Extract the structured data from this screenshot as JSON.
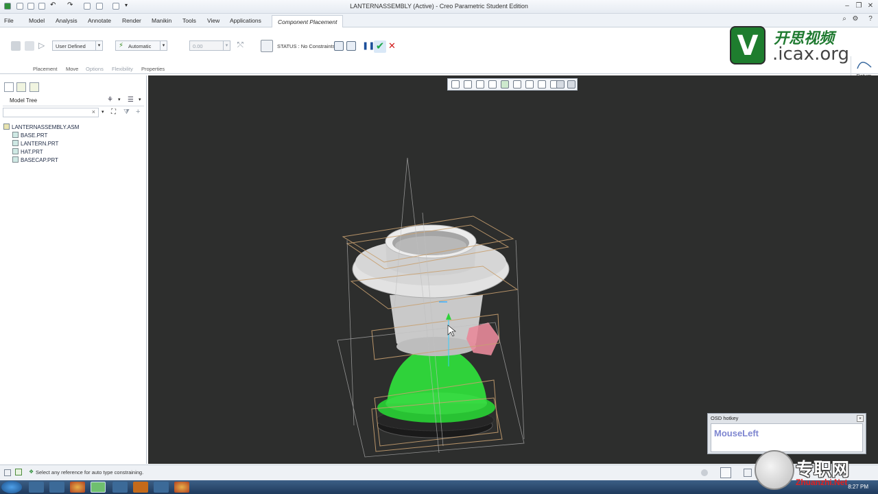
{
  "window": {
    "title": "LANTERNASSEMBLY (Active) - Creo Parametric Student Edition"
  },
  "menu": {
    "tabs": [
      "File",
      "Model",
      "Analysis",
      "Annotate",
      "Render",
      "Manikin",
      "Tools",
      "View",
      "Applications"
    ],
    "active_tab": "Component Placement"
  },
  "ribbon": {
    "constraint_set": "User Defined",
    "constraint_type": "Automatic",
    "offset_value": "0.00",
    "status": "STATUS : No Constraints",
    "subtabs": [
      {
        "label": "Placement",
        "enabled": true
      },
      {
        "label": "Move",
        "enabled": true
      },
      {
        "label": "Options",
        "enabled": false
      },
      {
        "label": "Flexibility",
        "enabled": false
      },
      {
        "label": "Properties",
        "enabled": true
      }
    ],
    "datum_label": "Datum"
  },
  "logo": {
    "letter": "V",
    "chinese": "开思视频",
    "site": ".icax.org"
  },
  "model_tree": {
    "title": "Model Tree",
    "root": "LANTERNASSEMBLY.ASM",
    "items": [
      "BASE.PRT",
      "LANTERN.PRT",
      "HAT.PRT",
      "BASECAP.PRT"
    ]
  },
  "osd": {
    "title": "OSD hotkey",
    "text": "MouseLeft"
  },
  "status_bar": {
    "message": "Select any reference for auto type constraining."
  },
  "taskbar": {
    "time": "8:27 PM"
  },
  "watermark": {
    "chinese": "专职网",
    "url": "Zhuanzhi.Net"
  },
  "colors": {
    "viewport_bg": "#2d2e2d",
    "hat": "#d9d9d9",
    "base": "#2fd23a",
    "basecap": "#1a1a1a",
    "selected_part": "#e88a9a",
    "wireframe": "#c8a070",
    "accept_green": "#1fa84a",
    "cancel_red": "#d01818",
    "logo_green": "#1e7d2e"
  }
}
